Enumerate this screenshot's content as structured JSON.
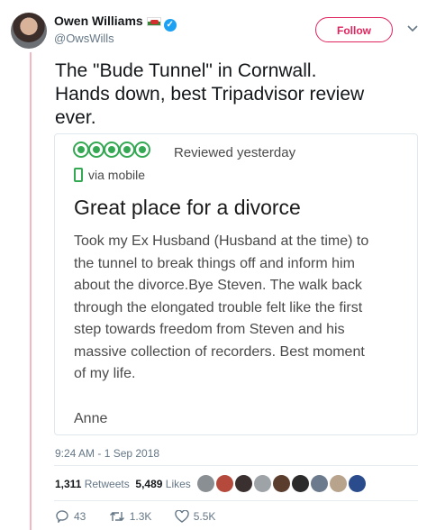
{
  "user": {
    "name": "Owen Williams",
    "handle": "@OwsWills",
    "follow_label": "Follow"
  },
  "tweet": {
    "lines": [
      "The \"Bude Tunnel\" in Cornwall.",
      "Hands down, best Tripadvisor review",
      "ever."
    ],
    "timestamp": "9:24 AM - 1 Sep 2018"
  },
  "review": {
    "rating": 5,
    "reviewed": "Reviewed yesterday",
    "via": "via mobile",
    "title": "Great place for a divorce",
    "body_lines": [
      "Took my Ex Husband (Husband at the time) to",
      "the tunnel to break things off and inform him",
      "about the divorce.Bye Steven. The walk back",
      "through the elongated trouble felt like the first",
      "step towards freedom from Steven and his",
      "massive collection of recorders. Best moment",
      "of my life."
    ],
    "author": "Anne",
    "accent_color": "#34a853"
  },
  "stats": {
    "retweets_count": "1,311",
    "retweets_label": "Retweets",
    "likes_count": "5,489",
    "likes_label": "Likes"
  },
  "actions": {
    "replies": "43",
    "retweets": "1.3K",
    "likes": "5.5K"
  },
  "colors": {
    "follow": "#e0245e",
    "verified": "#1da1f2",
    "thread_bar": "#f4b6c2"
  }
}
